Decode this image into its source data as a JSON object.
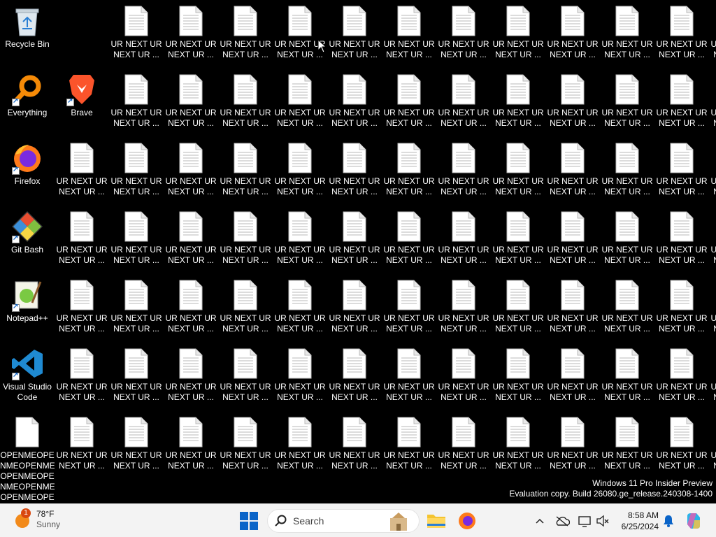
{
  "desktop": {
    "icons": {
      "recycle_bin": "Recycle Bin",
      "everything": "Everything",
      "brave": "Brave",
      "firefox": "Firefox",
      "git_bash": "Git Bash",
      "notepadpp": "Notepad++",
      "vscode_line1": "Visual Studio",
      "vscode_line2": "Code",
      "openme_lines": [
        "OPENMEOPE",
        "NMEOPENME",
        "OPENMEOPE",
        "NMEOPENME",
        "OPENMEOPE"
      ]
    },
    "file_label_line1": "UR NEXT UR",
    "file_label_line2": "NEXT UR ..."
  },
  "watermark": {
    "line1": "Windows 11 Pro Insider Preview",
    "line2": "Evaluation copy. Build 26080.ge_release.240308-1400"
  },
  "taskbar": {
    "weather_temp": "78°F",
    "weather_cond": "Sunny",
    "weather_badge": "1",
    "search_placeholder": "Search",
    "time": "8:58 AM",
    "date": "6/25/2024"
  },
  "colors": {
    "taskbar_bg": "#f3f3f3",
    "accent_blue": "#0a64c8",
    "desktop_bg": "#000000"
  }
}
